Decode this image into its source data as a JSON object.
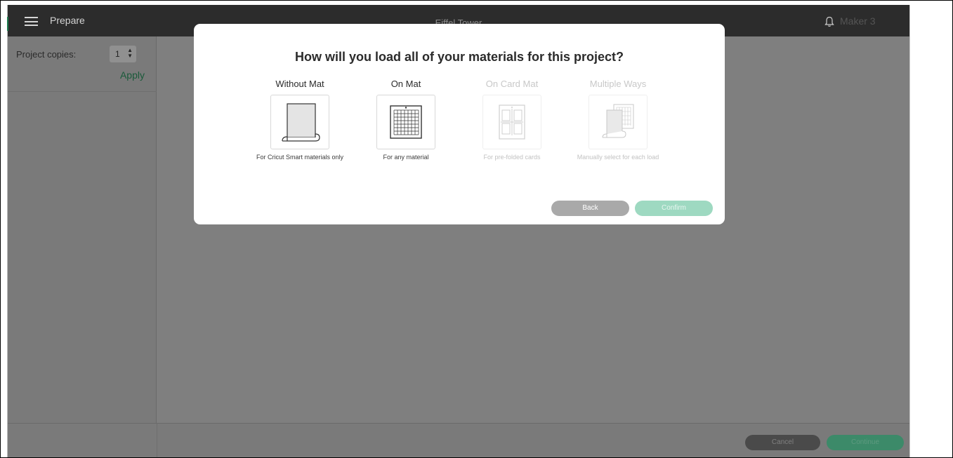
{
  "header": {
    "title": "Prepare",
    "project_name": "Eiffel Tower",
    "machine": "Maker 3",
    "menu_icon": "hamburger-menu-icon",
    "notification_icon": "bell-icon"
  },
  "left_panel": {
    "copies_label": "Project copies:",
    "copies_value": "1",
    "apply_label": "Apply"
  },
  "modal": {
    "title": "How will you load all of your materials for this project?",
    "options": [
      {
        "label": "Without Mat",
        "description": "For Cricut Smart materials only",
        "icon": "roll-material-icon",
        "enabled": true
      },
      {
        "label": "On Mat",
        "description": "For any material",
        "icon": "cutting-mat-icon",
        "enabled": true
      },
      {
        "label": "On Card Mat",
        "description": "For pre-folded cards",
        "icon": "card-mat-icon",
        "enabled": false
      },
      {
        "label": "Multiple Ways",
        "description": "Manually select for each load",
        "icon": "multiple-ways-icon",
        "enabled": false
      }
    ],
    "back_label": "Back",
    "confirm_label": "Confirm"
  },
  "bottom_bar": {
    "cancel_label": "Cancel",
    "continue_label": "Continue"
  },
  "colors": {
    "accent_green": "#1d7a4d",
    "confirm_green": "#9ed9c1",
    "overlay_gray": "#7f7f7f",
    "header_dark": "#2c2c2c"
  }
}
